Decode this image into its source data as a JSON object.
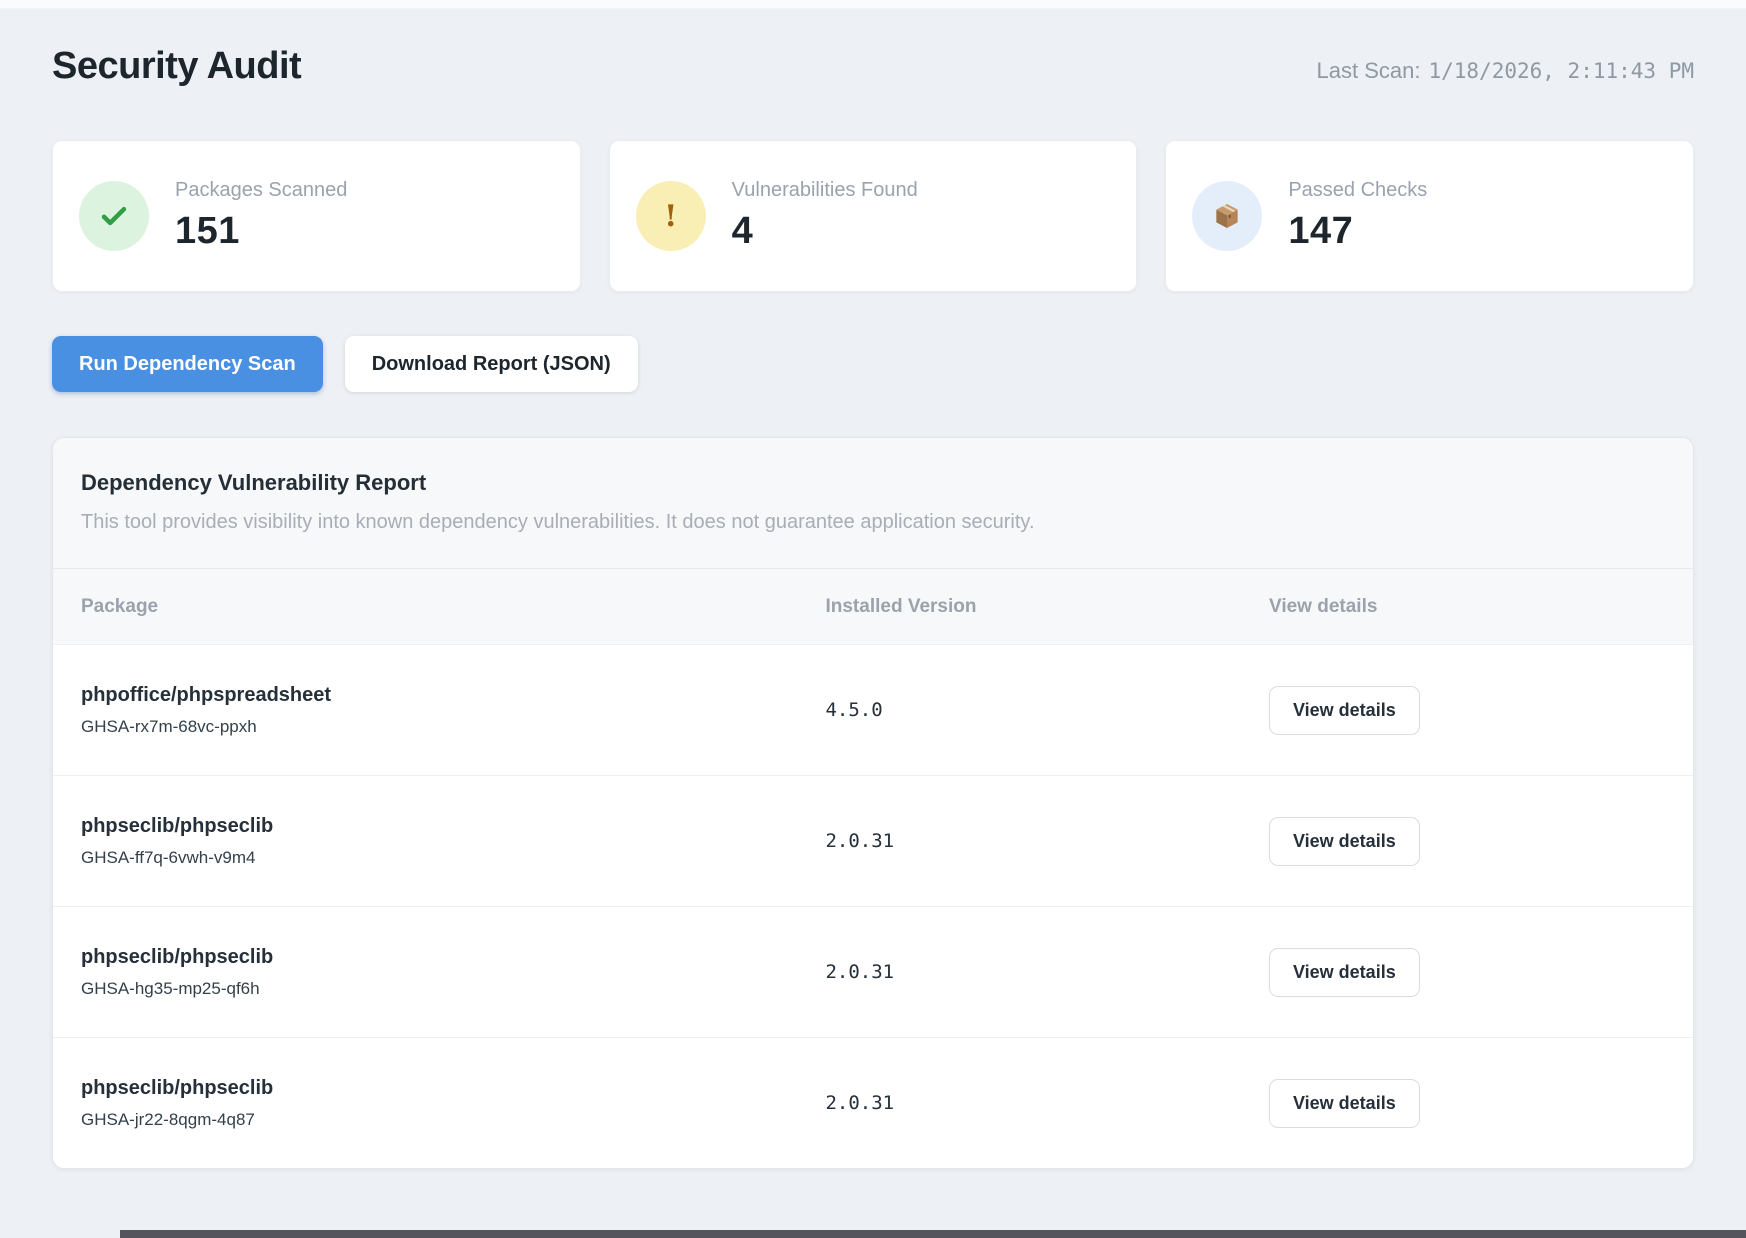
{
  "page": {
    "title": "Security Audit",
    "last_scan_label": "Last Scan:",
    "last_scan_value": "1/18/2026, 2:11:43 PM"
  },
  "stats": [
    {
      "label": "Packages Scanned",
      "value": "151",
      "icon": "check-icon",
      "icon_bg": "#dcf3e0",
      "icon_color": "#2f9e44"
    },
    {
      "label": "Vulnerabilities Found",
      "value": "4",
      "icon": "warning-icon",
      "icon_bg": "#f9efb4",
      "icon_color": "#a16207",
      "glyph": "!"
    },
    {
      "label": "Passed Checks",
      "value": "147",
      "icon": "package-icon",
      "icon_bg": "#e4eefb",
      "icon_color": "#a9815d"
    }
  ],
  "actions": {
    "run_scan_label": "Run Dependency Scan",
    "download_report_label": "Download Report (JSON)"
  },
  "report": {
    "title": "Dependency Vulnerability Report",
    "description": "This tool provides visibility into known dependency vulnerabilities. It does not guarantee application security.",
    "columns": {
      "package": "Package",
      "version": "Installed Version",
      "details": "View details"
    },
    "view_details_label": "View details",
    "rows": [
      {
        "package": "phpoffice/phpspreadsheet",
        "advisory": "GHSA-rx7m-68vc-ppxh",
        "version": "4.5.0"
      },
      {
        "package": "phpseclib/phpseclib",
        "advisory": "GHSA-ff7q-6vwh-v9m4",
        "version": "2.0.31"
      },
      {
        "package": "phpseclib/phpseclib",
        "advisory": "GHSA-hg35-mp25-qf6h",
        "version": "2.0.31"
      },
      {
        "package": "phpseclib/phpseclib",
        "advisory": "GHSA-jr22-8qgm-4q87",
        "version": "2.0.31"
      }
    ]
  },
  "colors": {
    "page_background": "#edf0f4",
    "primary_button": "#4a90e2",
    "success_green": "#2f9e44",
    "warning_amber": "#a16207",
    "muted_text": "#9aa2ac",
    "dark_text": "#1d252d"
  }
}
